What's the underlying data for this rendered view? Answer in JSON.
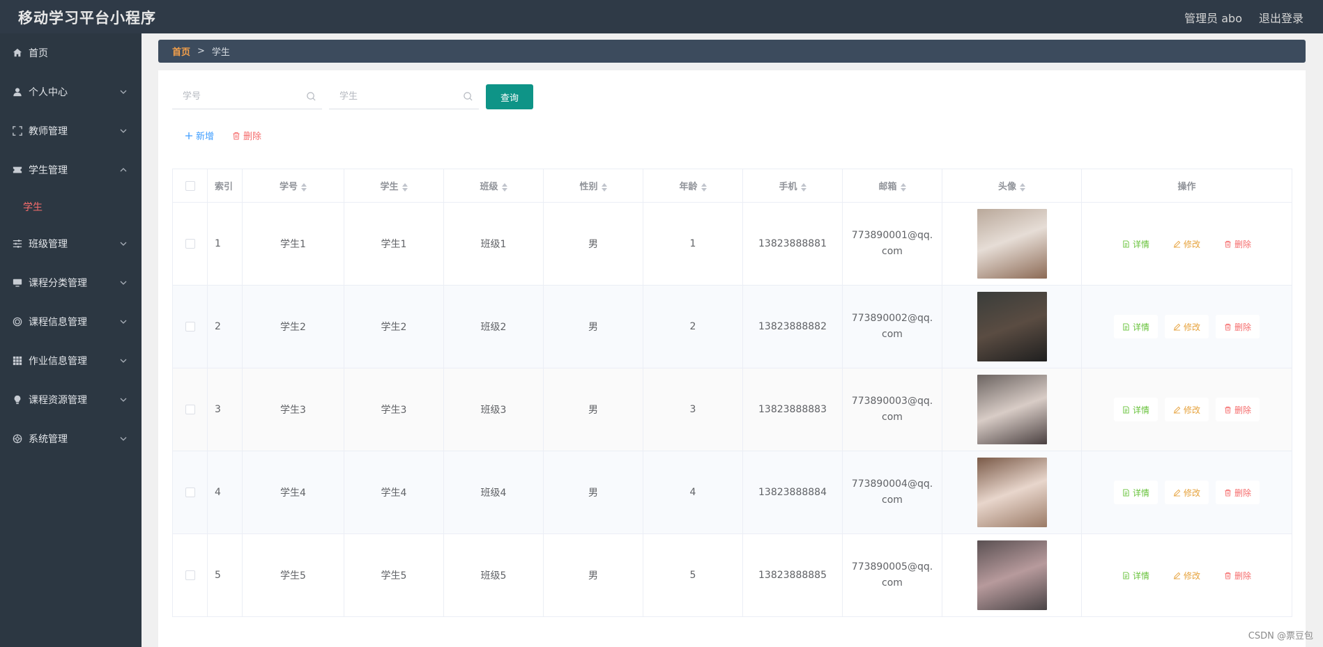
{
  "header": {
    "app_title": "移动学习平台小程序",
    "admin_label": "管理员 abo",
    "logout_label": "退出登录"
  },
  "sidebar": {
    "items": [
      {
        "label": "首页",
        "icon": "home-icon",
        "has_children": false
      },
      {
        "label": "个人中心",
        "icon": "user-icon",
        "has_children": true
      },
      {
        "label": "教师管理",
        "icon": "fullscreen-icon",
        "has_children": true
      },
      {
        "label": "学生管理",
        "icon": "ticket-icon",
        "has_children": true,
        "expanded": true
      },
      {
        "label": "班级管理",
        "icon": "sliders-icon",
        "has_children": true
      },
      {
        "label": "课程分类管理",
        "icon": "monitor-icon",
        "has_children": true
      },
      {
        "label": "课程信息管理",
        "icon": "target-icon",
        "has_children": true
      },
      {
        "label": "作业信息管理",
        "icon": "grid-icon",
        "has_children": true
      },
      {
        "label": "课程资源管理",
        "icon": "bulb-icon",
        "has_children": true
      },
      {
        "label": "系统管理",
        "icon": "help-icon",
        "has_children": true
      }
    ],
    "sub_item": "学生",
    "active_color": "#f56c6c"
  },
  "breadcrumb": {
    "home": "首页",
    "separator": ">",
    "current": "学生"
  },
  "search": {
    "field1_placeholder": "学号",
    "field2_placeholder": "学生",
    "query_label": "查询"
  },
  "actions": {
    "add_label": "新增",
    "delete_label": "删除"
  },
  "table": {
    "headers": [
      "索引",
      "学号",
      "学生",
      "班级",
      "性别",
      "年龄",
      "手机",
      "邮箱",
      "头像",
      "操作"
    ],
    "rows": [
      {
        "index": "1",
        "student_no": "学生1",
        "student": "学生1",
        "class": "班级1",
        "gender": "男",
        "age": "1",
        "phone": "13823888881",
        "email": "773890001@qq.com"
      },
      {
        "index": "2",
        "student_no": "学生2",
        "student": "学生2",
        "class": "班级2",
        "gender": "男",
        "age": "2",
        "phone": "13823888882",
        "email": "773890002@qq.com"
      },
      {
        "index": "3",
        "student_no": "学生3",
        "student": "学生3",
        "class": "班级3",
        "gender": "男",
        "age": "3",
        "phone": "13823888883",
        "email": "773890003@qq.com"
      },
      {
        "index": "4",
        "student_no": "学生4",
        "student": "学生4",
        "class": "班级4",
        "gender": "男",
        "age": "4",
        "phone": "13823888884",
        "email": "773890004@qq.com"
      },
      {
        "index": "5",
        "student_no": "学生5",
        "student": "学生5",
        "class": "班级5",
        "gender": "男",
        "age": "5",
        "phone": "13823888885",
        "email": "773890005@qq.com"
      }
    ],
    "ops": {
      "detail": "详情",
      "edit": "修改",
      "delete": "删除"
    }
  },
  "watermark": "CSDN @票豆包",
  "colors": {
    "topbar": "#2f3a47",
    "sidebar": "#2c3742",
    "breadcrumb_bar": "#3c4b5d",
    "query_button": "#0e9487",
    "detail": "#67c23a",
    "edit": "#e6a23c",
    "delete": "#f56c6c",
    "add": "#409eff"
  }
}
